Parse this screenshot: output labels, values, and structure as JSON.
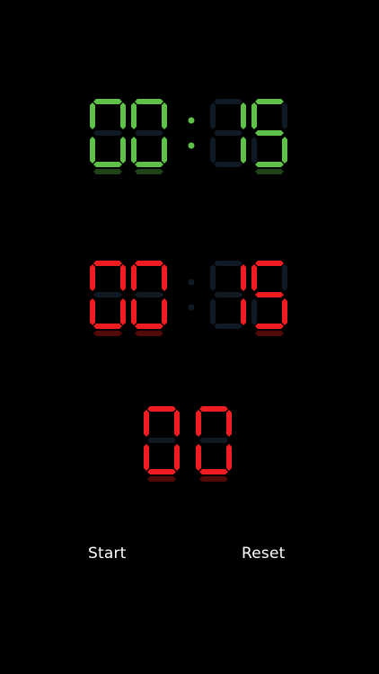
{
  "colors": {
    "background": "#000000",
    "green_on": "#5fc04a",
    "red_on": "#ee1d22",
    "segment_off": "#0f1a24"
  },
  "displays": {
    "top_timer": {
      "minutes": "00",
      "seconds": "15",
      "color": "green",
      "colon_lit": true
    },
    "bottom_timer": {
      "minutes": "00",
      "seconds": "15",
      "color": "red",
      "colon_lit": false
    },
    "counter": {
      "value": "00",
      "color": "red"
    }
  },
  "controls": {
    "start_label": "Start",
    "reset_label": "Reset"
  }
}
